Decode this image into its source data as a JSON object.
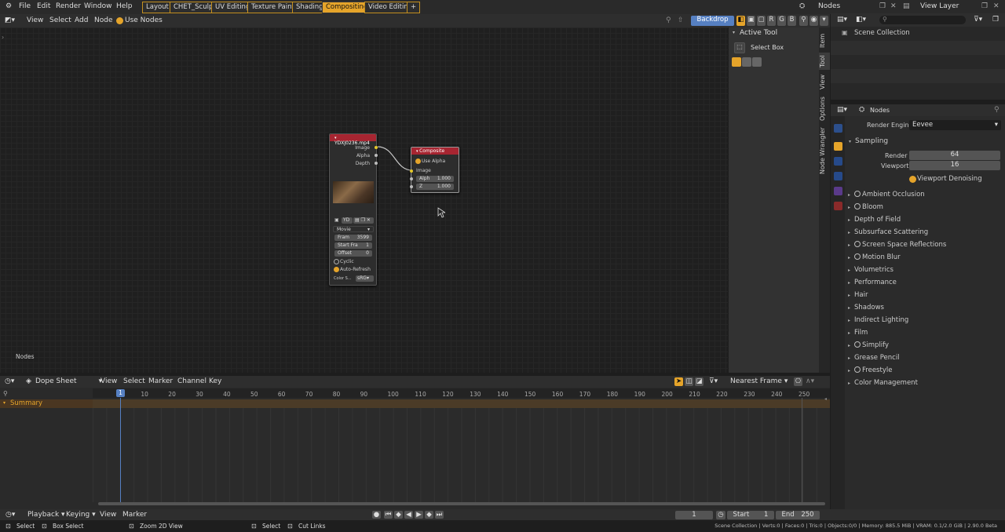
{
  "topbar": {
    "menus": [
      "File",
      "Edit",
      "Render",
      "Window",
      "Help"
    ],
    "workspaces": [
      "Layout",
      "CHET_Sculpt",
      "UV Editing",
      "Texture Paint",
      "Shading",
      "Compositing",
      "Video Editing",
      "+"
    ],
    "scene": "Nodes",
    "view_layer": "View Layer"
  },
  "node_header": {
    "menus": [
      "View",
      "Select",
      "Add",
      "Node"
    ],
    "use_nodes": "Use Nodes",
    "backdrop": "Backdrop"
  },
  "node_editor": {
    "label": "Nodes"
  },
  "movie_node": {
    "title": "YDXJ0236.mp4",
    "outputs": [
      "Image",
      "Alpha",
      "Depth"
    ],
    "source_short": "YD",
    "source": "Movie",
    "fields": [
      {
        "label": "Fram",
        "value": "3599"
      },
      {
        "label": "Start Fra",
        "value": "1"
      },
      {
        "label": "Offset",
        "value": "0"
      }
    ],
    "cyclic": "Cyclic",
    "auto_refresh": "Auto-Refresh",
    "color_label": "Color S...",
    "color_value": "sRG"
  },
  "composite_node": {
    "title": "Composite",
    "use_alpha": "Use Alpha",
    "input": "Image",
    "fields": [
      {
        "label": "Alph",
        "value": "1.000"
      },
      {
        "label": "Z",
        "value": "1.000"
      }
    ]
  },
  "tool_panel": {
    "title": "Active Tool",
    "tool": "Select Box"
  },
  "side_tabs": [
    "Item",
    "Tool",
    "View",
    "Options",
    "Node Wrangler"
  ],
  "outliner": {
    "search_placeholder": "",
    "collection": "Scene Collection"
  },
  "properties": {
    "context": "Nodes",
    "render_engine_label": "Render Engine",
    "render_engine": "Eevee",
    "sampling": "Sampling",
    "render_label": "Render",
    "render_value": "64",
    "viewport_label": "Viewport",
    "viewport_value": "16",
    "viewport_denoising": "Viewport Denoising",
    "sections": [
      {
        "label": "Ambient Occlusion",
        "check": true
      },
      {
        "label": "Bloom",
        "check": true
      },
      {
        "label": "Depth of Field",
        "check": false
      },
      {
        "label": "Subsurface Scattering",
        "check": false
      },
      {
        "label": "Screen Space Reflections",
        "check": true
      },
      {
        "label": "Motion Blur",
        "check": true
      },
      {
        "label": "Volumetrics",
        "check": false
      },
      {
        "label": "Performance",
        "check": false
      },
      {
        "label": "Hair",
        "check": false
      },
      {
        "label": "Shadows",
        "check": false
      },
      {
        "label": "Indirect Lighting",
        "check": false
      },
      {
        "label": "Film",
        "check": false
      },
      {
        "label": "Simplify",
        "check": true
      },
      {
        "label": "Grease Pencil",
        "check": false
      },
      {
        "label": "Freestyle",
        "check": true
      },
      {
        "label": "Color Management",
        "check": false
      }
    ]
  },
  "dopesheet": {
    "mode": "Dope Sheet",
    "menus": [
      "View",
      "Select",
      "Marker",
      "Channel",
      "Key"
    ],
    "snap": "Nearest Frame",
    "summary": "Summary",
    "current_frame": "1",
    "ticks": [
      "10",
      "20",
      "30",
      "40",
      "50",
      "60",
      "70",
      "80",
      "90",
      "100",
      "110",
      "120",
      "130",
      "140",
      "150",
      "160",
      "170",
      "180",
      "190",
      "200",
      "210",
      "220",
      "230",
      "240",
      "250"
    ]
  },
  "playback": {
    "menus": [
      "Playback",
      "Keying",
      "View",
      "Marker"
    ],
    "frame": "1",
    "start_label": "Start",
    "start": "1",
    "end_label": "End",
    "end": "250"
  },
  "statusbar": {
    "items": [
      "Select",
      "Box Select",
      "Zoom 2D View",
      "Select",
      "Cut Links"
    ],
    "info": "Scene Collection | Verts:0 | Faces:0 | Tris:0 | Objects:0/0 | Memory: 885.5 MiB | VRAM: 0.1/2.0 GiB | 2.90.0 Beta"
  },
  "colors": {
    "accent": "#e5a42a",
    "node_header": "#a72531",
    "select": "#5680c2"
  }
}
